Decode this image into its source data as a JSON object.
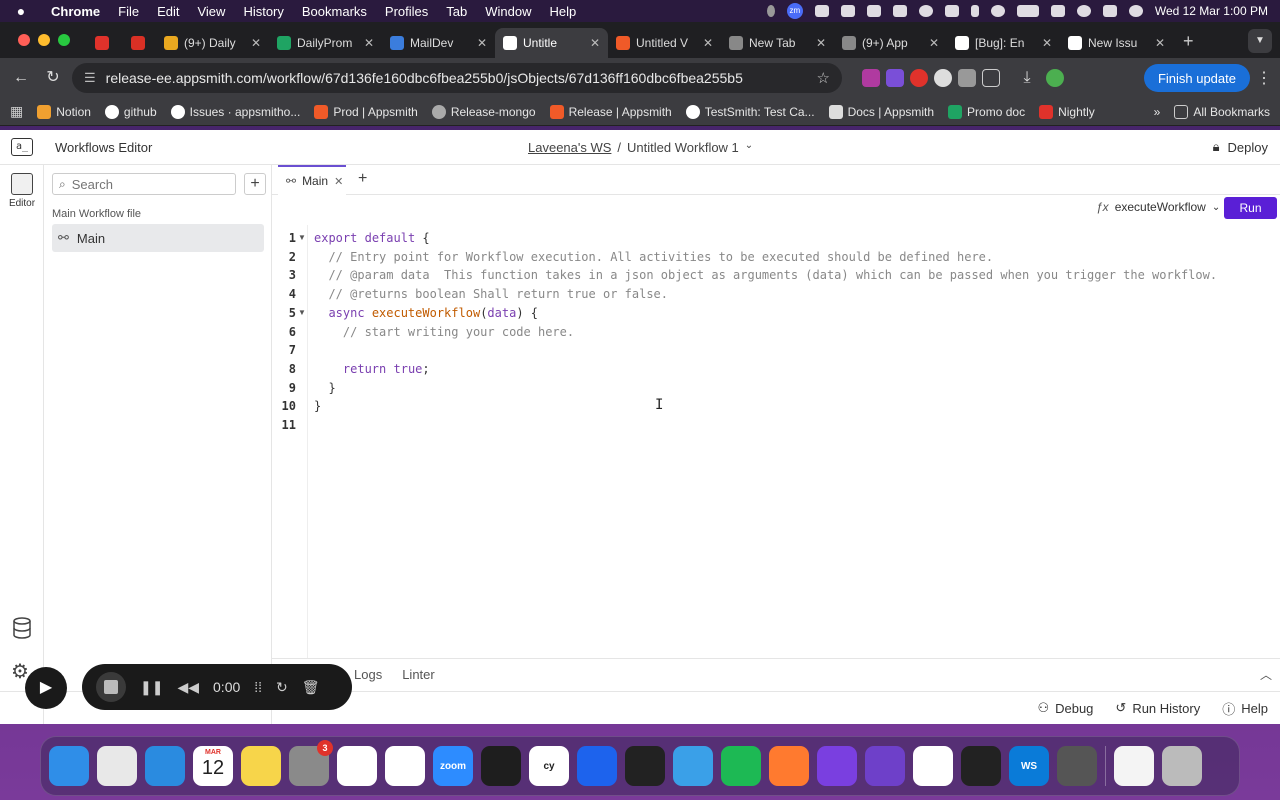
{
  "menubar": {
    "app": "Chrome",
    "items": [
      "File",
      "Edit",
      "View",
      "History",
      "Bookmarks",
      "Profiles",
      "Tab",
      "Window",
      "Help"
    ],
    "clock": "Wed 12 Mar  1:00 PM"
  },
  "tabs": [
    {
      "title": "",
      "icon": "record-icon",
      "color": "#e0322b"
    },
    {
      "title": "",
      "icon": "gmail-icon",
      "color": "#d93025"
    },
    {
      "title": "(9+) Daily",
      "icon": "slack-icon",
      "color": "#e9a820"
    },
    {
      "title": "DailyProm",
      "icon": "sheets-icon",
      "color": "#1fa463"
    },
    {
      "title": "MailDev",
      "icon": "mail-icon",
      "color": "#3b7ddd"
    },
    {
      "title": "Untitle",
      "icon": "appsmith-icon",
      "color": "#ffffff"
    },
    {
      "title": "Untitled V",
      "icon": "appsmith-red-icon",
      "color": "#f05a28"
    },
    {
      "title": "New Tab",
      "icon": "chrome-icon",
      "color": "#888888"
    },
    {
      "title": "(9+) App",
      "icon": "folder-icon",
      "color": "#888888"
    },
    {
      "title": "[Bug]: En",
      "icon": "github-icon",
      "color": "#ffffff"
    },
    {
      "title": "New Issu",
      "icon": "github-icon",
      "color": "#ffffff"
    }
  ],
  "address": {
    "url": "release-ee.appsmith.com/workflow/67d136fe160dbc6fbea255b0/jsObjects/67d136ff160dbc6fbea255b5",
    "finish_update": "Finish update"
  },
  "bookmarks": [
    {
      "label": "Notion",
      "color": "#f0a030"
    },
    {
      "label": "github",
      "color": "#ffffff"
    },
    {
      "label": "Issues · appsmitho...",
      "color": "#ffffff"
    },
    {
      "label": "Prod | Appsmith",
      "color": "#f05a28"
    },
    {
      "label": "Release-mongo",
      "color": "#aaaaaa"
    },
    {
      "label": "Release | Appsmith",
      "color": "#f05a28"
    },
    {
      "label": "TestSmith: Test Ca...",
      "color": "#ffffff"
    },
    {
      "label": "Docs | Appsmith",
      "color": "#dddddd"
    },
    {
      "label": "Promo doc",
      "color": "#1fa463"
    },
    {
      "label": "Nightly",
      "color": "#e0322b"
    }
  ],
  "bookmarks_all": "All Bookmarks",
  "app": {
    "editor_title": "Workflows Editor",
    "workspace": "Laveena's WS",
    "separator": "/",
    "workflow_name": "Untitled Workflow 1",
    "deploy": "Deploy",
    "rail_editor": "Editor",
    "search_placeholder": "Search",
    "file_section": "Main Workflow file",
    "main_item": "Main",
    "main_tab": "Main",
    "function_name": "executeWorkflow",
    "run": "Run",
    "bottom_tabs": [
      "Logs",
      "Linter"
    ],
    "status": {
      "debug": "Debug",
      "run_history": "Run History",
      "help": "Help"
    }
  },
  "code_lines": [
    "export default {",
    "  // Entry point for Workflow execution. All activities to be executed should be defined here.",
    "  // @param data  This function takes in a json object as arguments (data) which can be passed when you trigger the workflow.",
    "  // @returns boolean Shall return true or false.",
    "  async executeWorkflow(data) {",
    "    // start writing your code here.",
    "",
    "    return true;",
    "  }",
    "}",
    ""
  ],
  "recorder": {
    "time": "0:00"
  },
  "dock": [
    {
      "name": "finder",
      "color": "#2f8ee8"
    },
    {
      "name": "launchpad",
      "color": "#e8e8e8"
    },
    {
      "name": "safari",
      "color": "#2a8be0"
    },
    {
      "name": "calendar",
      "color": "#ffffff",
      "month": "MAR",
      "day": "12"
    },
    {
      "name": "notes",
      "color": "#f7d54a"
    },
    {
      "name": "system-settings",
      "color": "#8a8a8a",
      "badge": "3"
    },
    {
      "name": "chrome",
      "color": "#ffffff"
    },
    {
      "name": "slack",
      "color": "#ffffff"
    },
    {
      "name": "zoom",
      "color": "#2d8cff",
      "label": "zoom"
    },
    {
      "name": "terminal",
      "color": "#1e1e1e"
    },
    {
      "name": "cypress",
      "color": "#ffffff",
      "label": "cy"
    },
    {
      "name": "docker",
      "color": "#1d63ed"
    },
    {
      "name": "cube",
      "color": "#222222"
    },
    {
      "name": "preview",
      "color": "#3aa0e8"
    },
    {
      "name": "spotify",
      "color": "#1db954"
    },
    {
      "name": "pen-app",
      "color": "#ff7a2f"
    },
    {
      "name": "firefox",
      "color": "#7a3fe0"
    },
    {
      "name": "github-desktop",
      "color": "#6e40c9"
    },
    {
      "name": "mongodb-compass",
      "color": "#ffffff"
    },
    {
      "name": "activity-monitor",
      "color": "#222222"
    },
    {
      "name": "webstorm",
      "color": "#0a7bd8",
      "label": "WS"
    },
    {
      "name": "calculator",
      "color": "#555555"
    },
    {
      "name": "document",
      "color": "#f4f4f4"
    },
    {
      "name": "trash",
      "color": "#bbbbbb"
    }
  ]
}
